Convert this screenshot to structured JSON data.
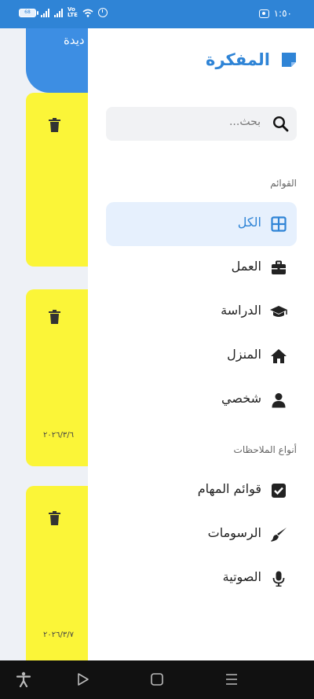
{
  "status_bar": {
    "battery_level": "68",
    "volte_label": "Vo\nLTE",
    "time": "١:٥٠"
  },
  "background_screen": {
    "fab_label": "ديدة",
    "notes": [
      {
        "date": ""
      },
      {
        "date": "٢٠٢٦/٣/٦"
      },
      {
        "date": "٢٠٢٦/٣/٧"
      }
    ]
  },
  "drawer": {
    "app_title": "المفكرة",
    "search": {
      "placeholder": "بحث..."
    },
    "lists_heading": "القوائم",
    "lists": [
      {
        "label": "الكل",
        "icon": "grid-icon",
        "active": true
      },
      {
        "label": "العمل",
        "icon": "briefcase-icon"
      },
      {
        "label": "الدراسة",
        "icon": "graduation-cap-icon"
      },
      {
        "label": "المنزل",
        "icon": "home-icon"
      },
      {
        "label": "شخصي",
        "icon": "user-icon"
      }
    ],
    "types_heading": "أنواع الملاحظات",
    "types": [
      {
        "label": "قوائم المهام",
        "icon": "checkbox-icon"
      },
      {
        "label": "الرسومات",
        "icon": "brush-icon"
      },
      {
        "label": "الصوتية",
        "icon": "microphone-icon"
      }
    ]
  },
  "colors": {
    "accent": "#2f84d6",
    "note_yellow": "#fbf538",
    "active_bg": "#e6f0fd"
  }
}
